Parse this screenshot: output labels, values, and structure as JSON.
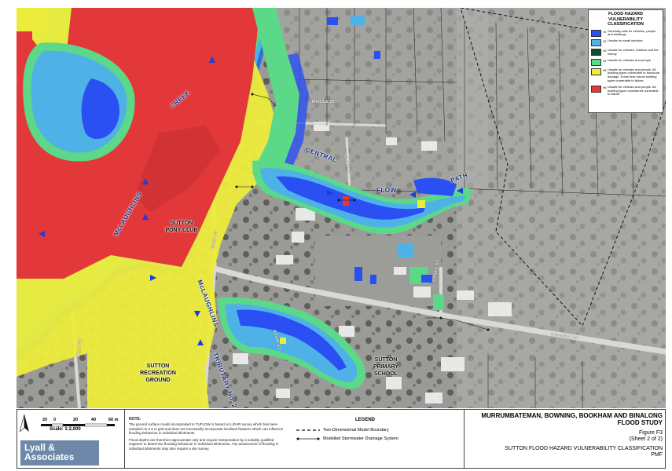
{
  "legend": {
    "title": "FLOOD HAZARD VULNERABILITY CLASSIFICATION",
    "items": [
      {
        "code": "H1",
        "color": "#2a4ff2",
        "label": "Generally safe for vehicles, people and buildings"
      },
      {
        "code": "H2",
        "color": "#4fb2e6",
        "label": "Unsafe for small vehicles"
      },
      {
        "code": "H3",
        "color": "#0f4d2e",
        "label": "Unsafe for vehicles, children and the elderly"
      },
      {
        "code": "H4",
        "color": "#5cd889",
        "label": "Unsafe for vehicles and people"
      },
      {
        "code": "H5",
        "color": "#ecec3c",
        "label": "Unsafe for vehicles and people. All building types vulnerable to structural damage. Some less robust building types vulnerable to failure."
      },
      {
        "code": "H6",
        "color": "#e2383a",
        "label": "Unsafe for vehicles and people. All building types considered vulnerable to failure."
      }
    ]
  },
  "map_labels": {
    "creek": "CREEK",
    "mclaughlins_1": "McLAUGHLINS",
    "sutton_pony_club": "SUTTON\nPONY CLUB",
    "central": "CENTRAL",
    "flow": "FLOW",
    "path": "PATH",
    "mclaughlins_2": "McLAUGHLINS",
    "tributary": "TRIBUTARY No. 2",
    "sutton_recreation_ground": "SUTTON\nRECREATION\nGROUND",
    "sutton_primary_school": "SUTTON\nPRIMARY\nSCHOOL"
  },
  "streets": [
    "MIDDLE ST",
    "CAMP ST",
    "CRAKE ST",
    "VICTORIA ST",
    "MILLY ST",
    "RIDGE ST",
    "CAMP ST"
  ],
  "scale": {
    "ticks": [
      "20",
      "0",
      "20",
      "40",
      "60 m"
    ],
    "label": "Scale: 1:2,000"
  },
  "logo": {
    "line1": "Lyall &",
    "line2": "Associates"
  },
  "note": {
    "heading": "NOTE:",
    "p1": "The ground surface model incorporated in TUFLOW is based on LiDAR survey which has been sampled on a 5 m grid and does not necessarily incorporate localised features which can influence flooding behaviour in individual allotments.",
    "p2": "Flood depths are therefore approximate only and require interpretation by a suitably qualified engineer to determine flooding behaviour in individual allotments. Any assessment of flooding in individual allotments may also require a site survey."
  },
  "legend2": {
    "title": "LEGEND",
    "boundary": "Two-Dimensional Model Boundary",
    "drainage": "Modelled Stormwater Drainage System"
  },
  "title_block": {
    "main_1": "MURRUMBATEMAN, BOWNING, BOOKHAM AND BINALONG",
    "main_2": "FLOOD STUDY",
    "figure": "Figure F3",
    "sheet": "(Sheet 2 of 2)",
    "sub_1": "SUTTON FLOOD HAZARD VULNERABILITY CLASSIFICATION",
    "sub_2": "PMF"
  }
}
